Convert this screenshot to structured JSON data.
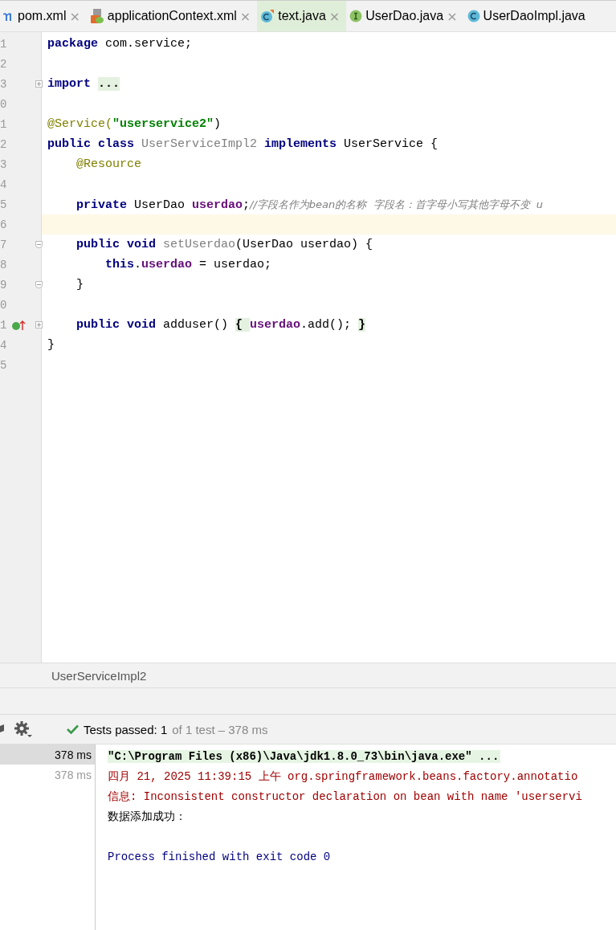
{
  "tabs": [
    {
      "label": "pom.xml",
      "kind": "maven",
      "close": "×",
      "selected": false
    },
    {
      "label": "applicationContext.xml",
      "kind": "xml",
      "close": "×",
      "selected": false
    },
    {
      "label": "text.java",
      "kind": "class-modified",
      "close": "×",
      "selected": true
    },
    {
      "label": "UserDao.java",
      "kind": "interface",
      "close": "×",
      "selected": false
    },
    {
      "label": "UserDaoImpl.java",
      "kind": "class",
      "selected": false
    }
  ],
  "editor": {
    "lines": [
      {
        "number": "1",
        "current": false,
        "tokens": [
          {
            "text": "package",
            "kind": "kw"
          },
          {
            "text": " com.service;",
            "kind": "plain"
          }
        ]
      },
      {
        "number": "2",
        "current": false
      },
      {
        "number": "3",
        "current": false,
        "fold_marker": true,
        "collapsed": true,
        "tokens": [
          {
            "text": "import ",
            "kind": "kw"
          },
          {
            "text": "...",
            "kind": "folded"
          }
        ]
      },
      {
        "number": "0",
        "current": false
      },
      {
        "number": "1",
        "current": false,
        "tokens": [
          {
            "text": "@Service(",
            "kind": "ann"
          },
          {
            "text": "\"userservice2\"",
            "kind": "str"
          },
          {
            "text": ")",
            "kind": "plain"
          }
        ]
      },
      {
        "number": "2",
        "current": false,
        "tokens": [
          {
            "text": "public class",
            "kind": "kw"
          },
          {
            "text": " UserServiceImpl2 ",
            "kind": "unused"
          },
          {
            "text": "implements",
            "kind": "kw"
          },
          {
            "text": " UserService {",
            "kind": "plain"
          }
        ]
      },
      {
        "number": "3",
        "current": false,
        "tokens": [
          {
            "text": "    @Resource",
            "kind": "ann"
          }
        ]
      },
      {
        "number": "4",
        "current": false
      },
      {
        "number": "5",
        "current": false,
        "tokens": [
          {
            "text": "    private",
            "kind": "kw"
          },
          {
            "text": " UserDao ",
            "kind": "plain"
          },
          {
            "text": "userdao",
            "kind": "field"
          },
          {
            "text": ";",
            "kind": "plain"
          },
          {
            "text": "//字段名作为bean的名称  字段名：首字母小写其他字母不变  u",
            "kind": "comment"
          }
        ]
      },
      {
        "number": "6",
        "current": true
      },
      {
        "number": "7",
        "current": false,
        "fold_marker": true,
        "collapsed": false,
        "tokens": [
          {
            "text": "    public void",
            "kind": "kw"
          },
          {
            "text": " setUserdao",
            "kind": "unused"
          },
          {
            "text": "(UserDao userdao) {",
            "kind": "plain"
          }
        ]
      },
      {
        "number": "8",
        "current": false,
        "tokens": [
          {
            "text": "        this",
            "kind": "kw"
          },
          {
            "text": ".",
            "kind": "plain"
          },
          {
            "text": "userdao",
            "kind": "field"
          },
          {
            "text": " = userdao;",
            "kind": "plain"
          }
        ]
      },
      {
        "number": "9",
        "current": false,
        "fold_marker": true,
        "collapsed": false,
        "tokens": [
          {
            "text": "    }",
            "kind": "plain"
          }
        ]
      },
      {
        "number": "0",
        "current": false
      },
      {
        "number": "1",
        "current": false,
        "fold_marker": true,
        "collapsed": true,
        "implements": true,
        "tokens": [
          {
            "text": "    public void",
            "kind": "kw"
          },
          {
            "text": " adduser() ",
            "kind": "plain"
          },
          {
            "text": "{ ",
            "kind": "folded"
          },
          {
            "text": "userdao",
            "kind": "field"
          },
          {
            "text": ".add(); ",
            "kind": "plain"
          },
          {
            "text": "}",
            "kind": "folded"
          }
        ]
      },
      {
        "number": "4",
        "current": false,
        "tokens": [
          {
            "text": "}",
            "kind": "plain"
          }
        ]
      },
      {
        "number": "5",
        "current": false
      }
    ]
  },
  "breadcrumb": "UserServiceImpl2",
  "run": {
    "status": "Tests passed: 1",
    "detail": "of 1 test – 378 ms",
    "tree": [
      {
        "time": "378 ms",
        "selected": true
      },
      {
        "time": "378 ms",
        "selected": false
      }
    ],
    "console": [
      {
        "text": "\"C:\\Program Files (x86)\\Java\\jdk1.8.0_73\\bin\\java.exe\" ...",
        "kind": "command"
      },
      {
        "text": "四月 21, 2025 11:39:15 上午 org.springframework.beans.factory.annotatio",
        "kind": "error"
      },
      {
        "text": "信息: Inconsistent constructor declaration on bean with name 'userservi",
        "kind": "error"
      },
      {
        "text": "数据添加成功：",
        "kind": "output"
      },
      {
        "kind": "blank"
      },
      {
        "text": "Process finished with exit code 0",
        "kind": "system"
      }
    ]
  }
}
